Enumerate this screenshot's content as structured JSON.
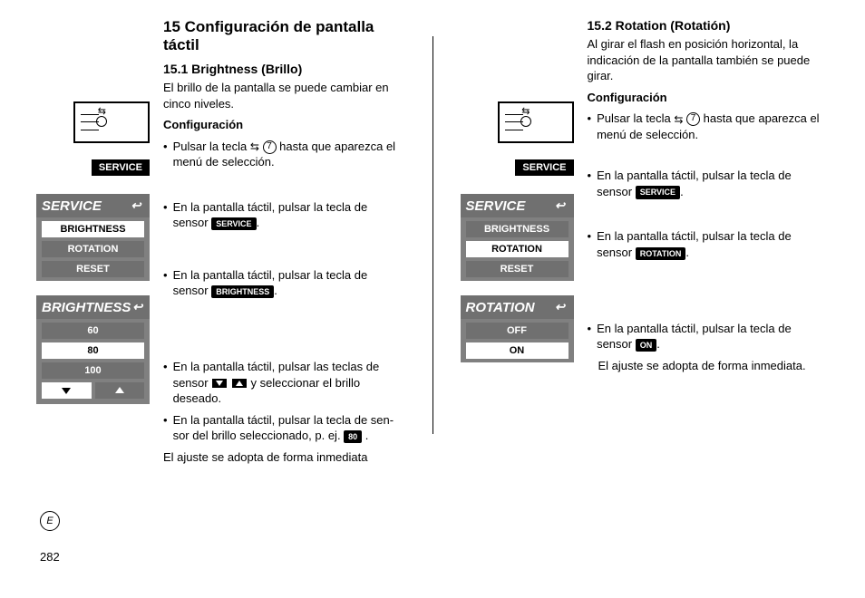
{
  "page_number": "282",
  "language_marker": "E",
  "section": {
    "title": "15 Configuración de pantalla táctil",
    "sub1": {
      "heading": "15.1 Brightness (Brillo)",
      "intro": "El brillo de la pantalla se puede cambiar en cinco niveles.",
      "config_label": "Configuración",
      "step1a": "Pulsar la tecla ",
      "step1_circ": "7",
      "step1b": " hasta que aparezca el menú de selección.",
      "step2a": "En la pantalla táctil, pulsar la tecla de sensor ",
      "step2_badge": "SERVICE",
      "step2b": ".",
      "step3a": "En la pantalla táctil, pulsar la tecla de sensor ",
      "step3_badge": "BRIGHTNESS",
      "step3b": ".",
      "step4a": "En la pantalla táctil, pulsar las teclas de sensor ",
      "step4b": " y seleccionar el brillo deseado.",
      "step5a": "En la pantalla táctil, pulsar la tecla de sen­sor del brillo seleccionado, p. ej. ",
      "step5_badge": "80",
      "step5b": " .",
      "note": "El ajuste se adopta de forma inmediata"
    },
    "sub2": {
      "heading": "15.2 Rotation (Rotatión)",
      "intro": "Al girar el flash en posición horizontal, la indicación de la pantalla también se puede girar.",
      "config_label": "Configuración",
      "step1a": "Pulsar la tecla ",
      "step1_circ": "7",
      "step1b": " hasta que aparezca el menú de selección.",
      "step2a": "En la pantalla táctil, pulsar la tecla de sensor ",
      "step2_badge": "SERVICE",
      "step2b": ".",
      "step3a": "En la pantalla táctil, pulsar la tecla de sensor ",
      "step3_badge": "ROTATION",
      "step3b": ".",
      "step4a": "En la pantalla táctil, pulsar la tecla de sensor ",
      "step4_badge": "ON",
      "step4b": ".",
      "note": "El ajuste se adopta de forma inmediata."
    }
  },
  "icons": {
    "svc_small": "SERVICE",
    "svc_menu_header": "SERVICE",
    "svc_menu_items": {
      "a": "BRIGHTNESS",
      "b": "ROTATION",
      "c": "RESET"
    },
    "bright_menu_header": "BRIGHTNESS",
    "bright_menu_items": {
      "a": "60",
      "b": "80",
      "c": "100"
    },
    "rot_menu_header": "ROTATION",
    "rot_menu_items": {
      "a": "OFF",
      "b": "ON"
    }
  }
}
